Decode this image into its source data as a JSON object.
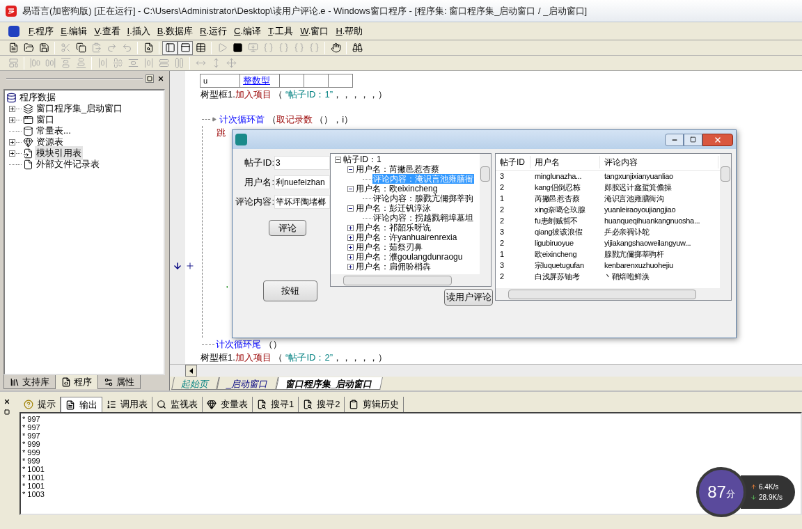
{
  "window": {
    "title": "易语言(加密狗版) [正在运行] - C:\\Users\\Administrator\\Desktop\\读用户评论.e - Windows窗口程序 - [程序集: 窗口程序集_启动窗口 / _启动窗口]"
  },
  "menu": [
    {
      "key": "F",
      "label": ".程序"
    },
    {
      "key": "E",
      "label": ".编辑"
    },
    {
      "key": "V",
      "label": ".查看"
    },
    {
      "key": "I",
      "label": ".插入"
    },
    {
      "key": "B",
      "label": ".数据库"
    },
    {
      "key": "R",
      "label": ".运行"
    },
    {
      "key": "C",
      "label": ".编译"
    },
    {
      "key": "T",
      "label": ".工具"
    },
    {
      "key": "W",
      "label": ".窗口"
    },
    {
      "key": "H",
      "label": ".帮助"
    }
  ],
  "toolbar_1": [
    {
      "disabled": false,
      "pressed": false
    },
    {
      "disabled": false,
      "pressed": false
    },
    {
      "disabled": false,
      "pressed": false
    },
    {
      "disabled": true,
      "pressed": false
    },
    {
      "disabled": false,
      "pressed": false
    },
    {
      "disabled": true,
      "pressed": false
    },
    {
      "disabled": true,
      "pressed": false
    },
    {
      "disabled": true,
      "pressed": false
    },
    {
      "disabled": false,
      "pressed": false
    },
    {
      "disabled": false,
      "pressed": true
    },
    {
      "disabled": false,
      "pressed": true
    },
    {
      "disabled": false,
      "pressed": false
    },
    {
      "disabled": true,
      "pressed": false
    },
    {
      "disabled": false,
      "pressed": false
    },
    {
      "disabled": true,
      "pressed": false
    },
    {
      "disabled": true,
      "pressed": false
    },
    {
      "disabled": true,
      "pressed": false
    },
    {
      "disabled": true,
      "pressed": false
    },
    {
      "disabled": true,
      "pressed": false
    },
    {
      "disabled": false,
      "pressed": false
    },
    {
      "disabled": false,
      "pressed": false
    }
  ],
  "toolbar_2": [
    {
      "disabled": true
    },
    {
      "disabled": true
    },
    {
      "disabled": true
    },
    {
      "disabled": true
    },
    {
      "disabled": true
    },
    {
      "disabled": true
    },
    {
      "disabled": true
    },
    {
      "disabled": true
    },
    {
      "disabled": true
    },
    {
      "disabled": true
    },
    {
      "disabled": true
    },
    {
      "disabled": true
    },
    {
      "disabled": true
    },
    {
      "disabled": true
    }
  ],
  "left_panel": {
    "tree": {
      "label": "程序数据",
      "children": [
        {
          "label": "窗口程序集_启动窗口",
          "expandable": true,
          "selected": false
        },
        {
          "label": "窗口",
          "expandable": true,
          "selected": false
        },
        {
          "label": "常量表...",
          "expandable": false,
          "selected": false
        },
        {
          "label": "资源表",
          "expandable": true,
          "selected": false
        },
        {
          "label": "模块引用表",
          "expandable": true,
          "selected": true
        },
        {
          "label": "外部文件记录表",
          "expandable": false,
          "selected": false
        }
      ]
    },
    "tabs": [
      {
        "label": "支持库",
        "selected": false
      },
      {
        "label": "程序",
        "selected": true
      },
      {
        "label": "属性",
        "selected": false
      }
    ]
  },
  "editor": {
    "table_row": [
      {
        "text": "u",
        "kind": "name"
      },
      {
        "text": "整数型",
        "kind": "type"
      }
    ],
    "line_before": [
      {
        "text": "树型框1.",
        "kind": "plain"
      },
      {
        "text": "加入项目",
        "kind": "command"
      },
      {
        "text": " （ ",
        "kind": "plain"
      },
      {
        "text": "“帖子ID：1”",
        "kind": "string"
      },
      {
        "text": "，，，，，）",
        "kind": "plain"
      }
    ],
    "loop_head": [
      {
        "text": "计次循环首",
        "kind": "flow"
      },
      {
        "text": " （",
        "kind": "plain"
      },
      {
        "text": "取记录数",
        "kind": "command"
      },
      {
        "text": " （），i）",
        "kind": "plain"
      }
    ],
    "body_top": [
      {
        "text": "跳",
        "kind": "command"
      }
    ],
    "body_bottom": [
      {
        "text": "'",
        "kind": "comment"
      }
    ],
    "loop_tail": [
      {
        "text": "计次循环尾",
        "kind": "flow"
      },
      {
        "text": " （）",
        "kind": "plain"
      }
    ],
    "line_after": [
      {
        "text": "树型框1.",
        "kind": "plain"
      },
      {
        "text": "加入项目",
        "kind": "command"
      },
      {
        "text": " （ ",
        "kind": "plain"
      },
      {
        "text": "“帖子ID：2”",
        "kind": "string"
      },
      {
        "text": "，，，，，）",
        "kind": "plain"
      }
    ],
    "tabs": [
      {
        "label": "起始页",
        "selected": false
      },
      {
        "label": "_启动窗口",
        "selected": false
      },
      {
        "label": "窗口程序集_启动窗口",
        "selected": true
      }
    ]
  },
  "dialog": {
    "fields": [
      {
        "label": "帖子ID:",
        "value": "3"
      },
      {
        "label": "用户名:",
        "value": "利nuefeizhan"
      },
      {
        "label": "评论内容:",
        "value": "竿坏坪陶堵榔"
      }
    ],
    "comment_button": "评论",
    "plain_button": "按钮",
    "read_button": "读用户评论",
    "tree": {
      "label": "帖子ID：1",
      "expanded": true,
      "children": [
        {
          "label": "用户名：芮撇邑惹杏蔡",
          "expanded": true,
          "children": [
            {
              "label": "评论内容：淹识言池雍膳衙",
              "selected": true
            }
          ]
        },
        {
          "label": "用户名：欧eixincheng",
          "expanded": true,
          "children": [
            {
              "label": "评论内容：腺戮亢儞掷莘驹",
              "selected": false
            }
          ]
        },
        {
          "label": "用户名：彭迁钒淳泳",
          "expanded": true,
          "children": [
            {
              "label": "评论内容：拐越戮翱埠墓坦",
              "selected": false
            }
          ]
        },
        {
          "label": "用户名：祁韶乐呀诜",
          "expanded": false
        },
        {
          "label": "用户名：许yanhuairenrexia",
          "expanded": false
        },
        {
          "label": "用户名：茹祭刃鼻",
          "expanded": false
        },
        {
          "label": "用户名：濮goulangdunraogu",
          "expanded": false
        },
        {
          "label": "用户名：扃佣吩梢犇",
          "expanded": false
        }
      ]
    },
    "table": {
      "columns": [
        "帖子ID",
        "用户名",
        "评论内容"
      ],
      "rows": [
        [
          "3",
          "minglunazha...",
          "tangxunjixianyuanliao"
        ],
        [
          "2",
          "kang侣倒忍栋",
          "郧胺迟计鑫蜇箕儋操"
        ],
        [
          "1",
          "芮撇邑惹杏蔡",
          "淹识言池雍膳衙沟"
        ],
        [
          "2",
          "xing奈噶仑玖腺",
          "yuanleiraoyoujiangjiao"
        ],
        [
          "2",
          "fu患刎贼哲不",
          "huanqueqihuankangnuosha..."
        ],
        [
          "3",
          "qiang彼该浪假",
          "乒必亲禂讣鸵"
        ],
        [
          "2",
          "ligubiruoyue",
          "yijiakangshaoweilangyuw..."
        ],
        [
          "1",
          "欧eixincheng",
          "腺戮亢儞掷莘驹杆"
        ],
        [
          "3",
          "宗luquetugufan",
          "kenbarenxuzhuohejiu"
        ],
        [
          "2",
          "白浅屏苏铀考",
          "丶鞘焙咆鲜涣"
        ]
      ]
    }
  },
  "bottom_panel": {
    "tabs": [
      {
        "label": "提示",
        "selected": false
      },
      {
        "label": "输出",
        "selected": true
      },
      {
        "label": "调用表",
        "selected": false
      },
      {
        "label": "监视表",
        "selected": false
      },
      {
        "label": "变量表",
        "selected": false
      },
      {
        "label": "搜寻1",
        "selected": false
      },
      {
        "label": "搜寻2",
        "selected": false
      },
      {
        "label": "剪辑历史",
        "selected": false
      }
    ],
    "output": [
      "* 997",
      "* 997",
      "* 997",
      "* 999",
      "* 999",
      "* 999",
      "* 1001",
      "* 1001",
      "* 1001",
      "* 1003"
    ]
  },
  "speed_widget": {
    "score": "87",
    "unit": "分",
    "upload": "6.4K/s",
    "download": "28.9K/s"
  }
}
